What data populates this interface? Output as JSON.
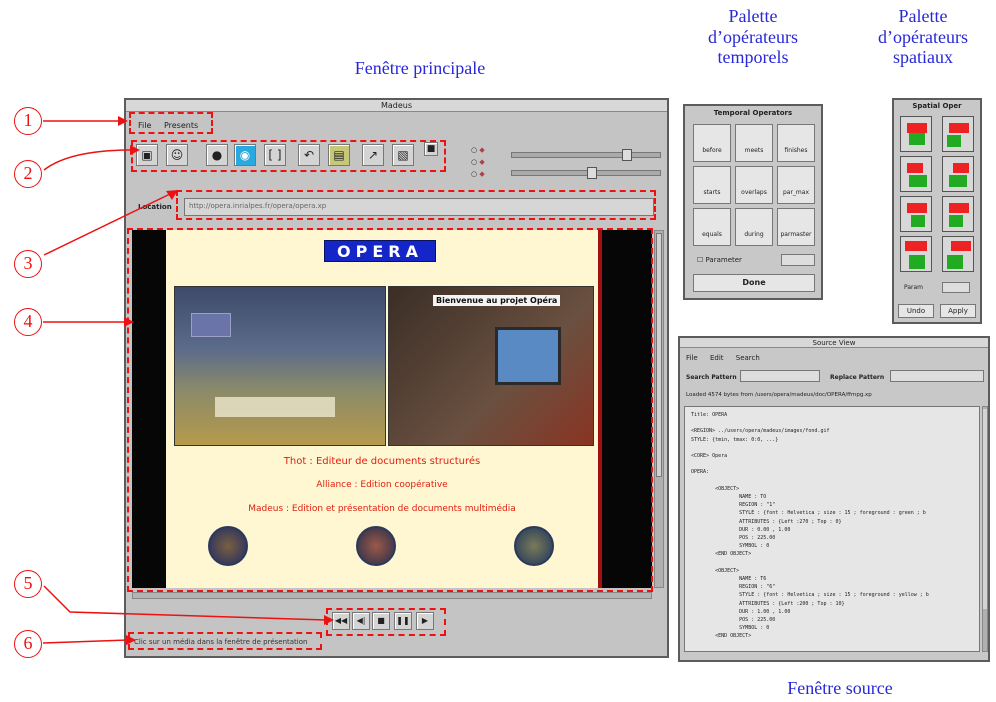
{
  "captions": {
    "main_window": "Fenêtre principale",
    "temporal_palette": [
      "Palette",
      "d’opérateurs",
      "temporels"
    ],
    "spatial_palette": [
      "Palette",
      "d’opérateurs",
      "spatiaux"
    ],
    "source_window": "Fenêtre source"
  },
  "callouts": [
    "1",
    "2",
    "3",
    "4",
    "5",
    "6"
  ],
  "main_window": {
    "title": "Madeus",
    "menu": [
      "File",
      "Presents"
    ],
    "location_label": "Location",
    "location_value": "http://opera.inrialpes.fr/opera/opera.xp",
    "document": {
      "banner": "OPERA",
      "video_caption": "Bienvenue au projet Opéra",
      "lines": [
        "Thot : Editeur de documents structurés",
        "Alliance : Edition coopérative",
        "Madeus : Edition et présentation de documents multimédia"
      ]
    },
    "status_text": "Clic sur un média dans la fenêtre de présentation",
    "toolbar_icons": [
      "camera-icon",
      "person-icon",
      "bomb-icon",
      "globe-icon",
      "bracket-icon",
      "undo-arrow-icon",
      "document-icon",
      "path-icon",
      "save-icon",
      "stop-icon"
    ],
    "playback_icons": [
      "rewind-icon",
      "step-icon",
      "stop-icon",
      "pause-icon",
      "play-icon"
    ]
  },
  "temporal_palette": {
    "title": "Temporal Operators",
    "operators": [
      "before",
      "meets",
      "finishes",
      "starts",
      "overlaps",
      "par_max",
      "equals",
      "during",
      "parmaster"
    ],
    "parameter_label": "Parameter",
    "done_label": "Done"
  },
  "spatial_palette": {
    "title": "Spatial Oper",
    "param_label": "Param",
    "undo_label": "Undo",
    "apply_label": "Apply"
  },
  "source_window": {
    "title": "Source View",
    "menu": [
      "File",
      "Edit",
      "Search"
    ],
    "search_label": "Search Pattern",
    "replace_label": "Replace Pattern",
    "info_line": "Loaded 4574 bytes from /users/opera/madeus/doc/OPERA/ffmpg.xp",
    "code_lines": [
      "Title: OPERA",
      "",
      "<REGION> ../users/opera/madeus/images/fond.gif",
      "STYLE: {tmin, tmax: 0:0, ...}",
      "",
      "<CORE> Opera",
      "",
      "OPERA:",
      "",
      "        <OBJECT>",
      "                NAME : TO",
      "                REGION : \"1\"",
      "                STYLE : {font : Helvetica ; size : 15 ; foreground : green ; b",
      "                ATTRIBUTES : {Left :270 ; Top : 0}",
      "                DUR : 0.00 , 1.00",
      "                POS : 225.00",
      "                SYMBOL : 0",
      "        <END OBJECT>",
      "",
      "        <OBJECT>",
      "                NAME : T6",
      "                REGION : \"6\"",
      "                STYLE : {font : Helvetica ; size : 15 ; foreground : yellow ; b",
      "                ATTRIBUTES : {Left :200 ; Top : 10}",
      "                DUR : 1.00 , 1.00",
      "                POS : 225.00",
      "                SYMBOL : 0",
      "        <END OBJECT>"
    ]
  }
}
